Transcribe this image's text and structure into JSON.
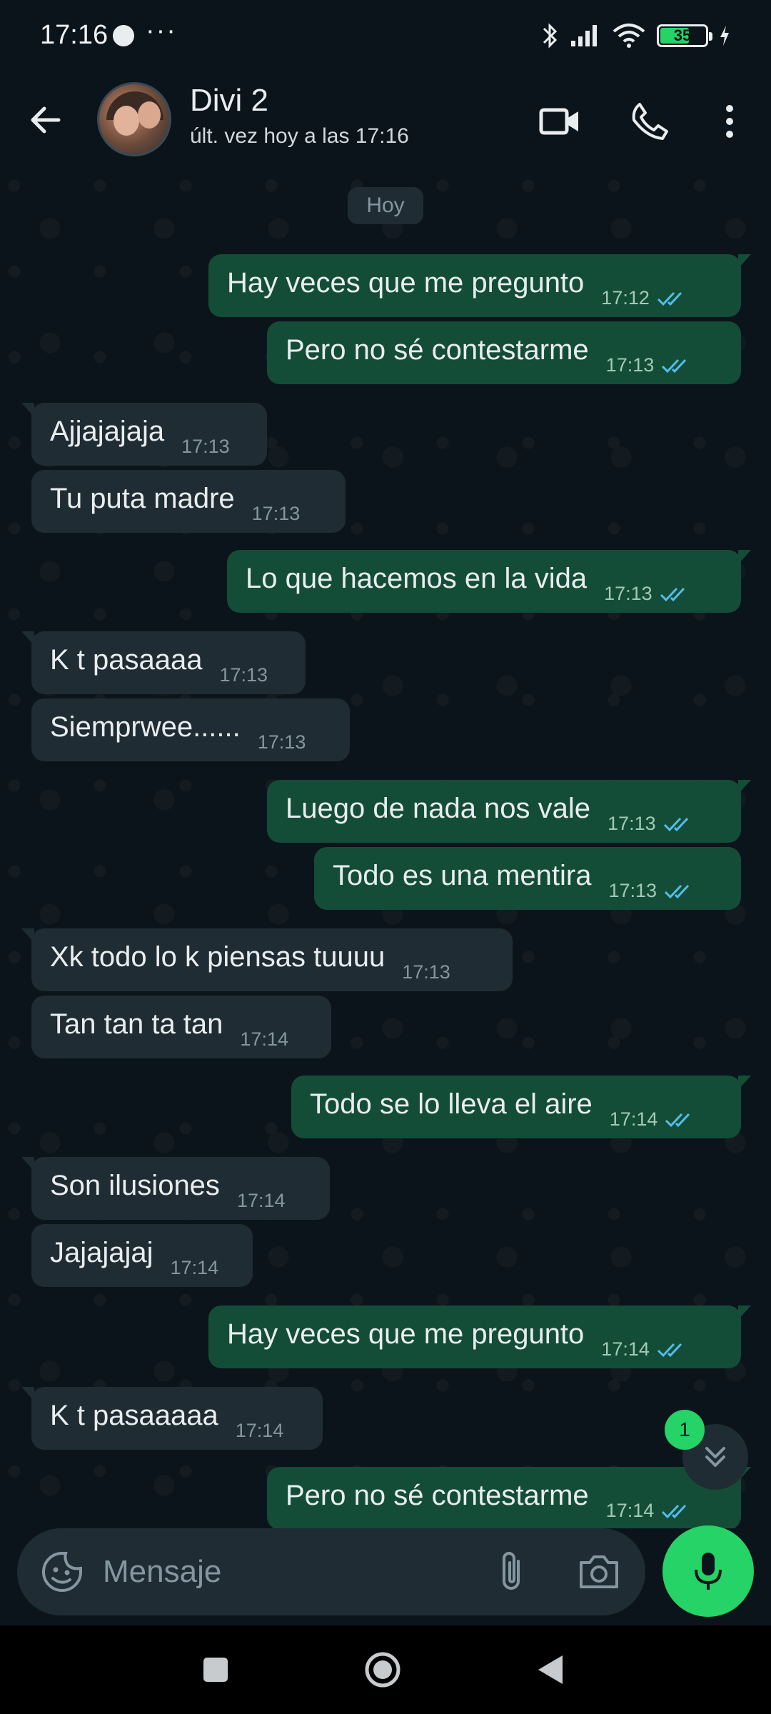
{
  "status_bar": {
    "time": "17:16",
    "more": "···",
    "battery": 35
  },
  "header": {
    "contact_name": "Divi 2",
    "last_seen": "últ. vez hoy a las 17:16"
  },
  "chat": {
    "date_chip": "Hoy",
    "messages": [
      {
        "dir": "out",
        "text": "Hay veces que me pregunto",
        "time": "17:12"
      },
      {
        "dir": "out",
        "text": "Pero no sé contestarme",
        "time": "17:13"
      },
      {
        "dir": "in",
        "text": "Ajjajajaja",
        "time": "17:13"
      },
      {
        "dir": "in",
        "text": "Tu puta madre",
        "time": "17:13"
      },
      {
        "dir": "out",
        "text": "Lo que hacemos en la vida",
        "time": "17:13"
      },
      {
        "dir": "in",
        "text": "K t pasaaaa",
        "time": "17:13"
      },
      {
        "dir": "in",
        "text": "Siemprwee......",
        "time": "17:13"
      },
      {
        "dir": "out",
        "text": "Luego de nada nos vale",
        "time": "17:13"
      },
      {
        "dir": "out",
        "text": "Todo es una mentira",
        "time": "17:13"
      },
      {
        "dir": "in",
        "text": "Xk todo lo k piensas tuuuu",
        "time": "17:13"
      },
      {
        "dir": "in",
        "text": "Tan tan ta tan",
        "time": "17:14"
      },
      {
        "dir": "out",
        "text": "Todo se lo lleva el aire",
        "time": "17:14"
      },
      {
        "dir": "in",
        "text": "Son ilusiones",
        "time": "17:14"
      },
      {
        "dir": "in",
        "text": "Jajajajaj",
        "time": "17:14"
      },
      {
        "dir": "out",
        "text": "Hay veces que me pregunto",
        "time": "17:14"
      },
      {
        "dir": "in",
        "text": "K t pasaaaaa",
        "time": "17:14"
      },
      {
        "dir": "out",
        "text": "Pero no sé contestarme",
        "time": "17:14"
      }
    ],
    "unread_count": "1"
  },
  "composer": {
    "placeholder": "Mensaje"
  },
  "colors": {
    "outgoing_bubble": "#144d37",
    "incoming_bubble": "#1f2c33",
    "accent": "#25d366",
    "read_ticks": "#53bdeb"
  }
}
